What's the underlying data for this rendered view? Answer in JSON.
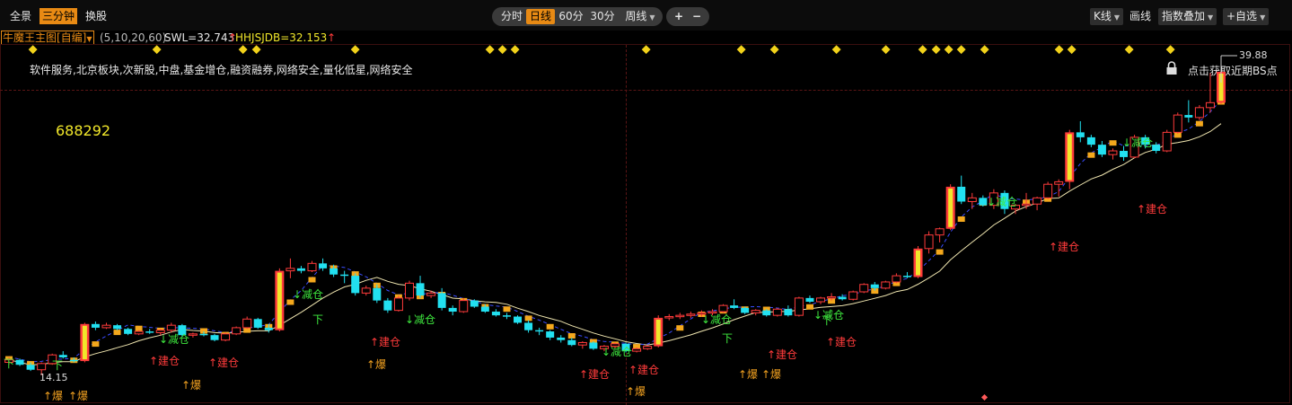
{
  "toolbar": {
    "left_tabs": [
      "全景",
      "三分钟",
      "换股"
    ],
    "active_left": "三分钟",
    "periods": [
      "分时",
      "日线",
      "60分",
      "30分"
    ],
    "active_period": "日线",
    "week_label": "周线",
    "plus_label": "+",
    "minus_label": "−",
    "kline_label": "K线",
    "draw_label": "画线",
    "index_overlay_label": "指数叠加",
    "add_watch_label": "+自选"
  },
  "legend": {
    "indicator": "牛魔王主图[自编]",
    "params": "(5,10,20,60)",
    "swl_label": "SWL=32.743",
    "swl_arrow": "↑",
    "hhjs_label": "HHJSJDB=32.153",
    "hhjs_arrow": "↑"
  },
  "stock": {
    "concepts": "软件服务,北京板块,次新股,中盘,基金增仓,融资融券,网络安全,量化低星,网络安全",
    "code": "688292",
    "high_label": "39.88",
    "low_label": "14.15",
    "bs_hint": "点击获取近期BS点"
  },
  "colors": {
    "up": "#ff3b3b",
    "down": "#22e0f0",
    "yellow_body": "#f0e62a",
    "ma_orange": "#f4a81c",
    "buy_signal": "#ff3b3b",
    "sell_signal": "#3ee83e",
    "boom_signal": "#f0a020",
    "accent": "#e88a14"
  },
  "icons": {
    "lock": "lock-icon",
    "diamond": "event-diamond-icon",
    "dropdown": "chevron-down-icon"
  },
  "signals": {
    "buy": "建仓",
    "sell": "减仓",
    "boom": "爆",
    "down": "下"
  },
  "chart_data": {
    "type": "candlestick",
    "price_range": [
      14.15,
      39.88
    ],
    "last_indicators": {
      "SWL": 32.743,
      "HHJSJDB": 32.153
    },
    "candles": [
      [
        15.2,
        15.6,
        15.0,
        15.4
      ],
      [
        15.4,
        15.5,
        14.9,
        15.0
      ],
      [
        15.0,
        15.2,
        14.5,
        14.6
      ],
      [
        14.6,
        15.2,
        14.15,
        15.1
      ],
      [
        15.1,
        15.9,
        15.0,
        15.8
      ],
      [
        15.8,
        16.1,
        15.5,
        15.6
      ],
      [
        15.4,
        15.6,
        15.2,
        15.3
      ],
      [
        15.3,
        18.4,
        15.2,
        18.3
      ],
      [
        18.3,
        18.5,
        17.8,
        18.0
      ],
      [
        18.0,
        18.4,
        17.9,
        18.2
      ],
      [
        18.2,
        18.3,
        17.8,
        17.9
      ],
      [
        17.9,
        18.0,
        17.4,
        17.5
      ],
      [
        17.5,
        17.8,
        17.4,
        17.7
      ],
      [
        17.7,
        17.9,
        17.5,
        17.6
      ],
      [
        17.6,
        17.9,
        17.4,
        17.8
      ],
      [
        17.8,
        18.4,
        17.6,
        18.2
      ],
      [
        18.2,
        18.3,
        17.3,
        17.4
      ],
      [
        17.4,
        17.6,
        17.2,
        17.5
      ],
      [
        17.5,
        17.7,
        17.3,
        17.4
      ],
      [
        17.4,
        17.5,
        16.9,
        17.0
      ],
      [
        17.0,
        17.6,
        16.9,
        17.5
      ],
      [
        17.5,
        18.1,
        17.4,
        18.0
      ],
      [
        18.0,
        18.9,
        17.9,
        18.7
      ],
      [
        18.7,
        18.8,
        17.9,
        18.0
      ],
      [
        18.0,
        18.3,
        17.6,
        17.8
      ],
      [
        17.8,
        22.8,
        17.7,
        22.6
      ],
      [
        22.6,
        23.6,
        22.0,
        22.8
      ],
      [
        22.8,
        23.0,
        22.4,
        22.6
      ],
      [
        22.6,
        23.4,
        22.5,
        23.2
      ],
      [
        23.2,
        23.6,
        22.6,
        22.8
      ],
      [
        22.8,
        23.1,
        22.1,
        22.3
      ],
      [
        22.3,
        22.6,
        21.6,
        22.2
      ],
      [
        22.2,
        22.4,
        20.6,
        20.8
      ],
      [
        20.8,
        21.4,
        20.6,
        21.2
      ],
      [
        21.2,
        21.5,
        20.0,
        20.2
      ],
      [
        20.2,
        20.4,
        19.2,
        19.4
      ],
      [
        19.4,
        20.6,
        19.3,
        20.4
      ],
      [
        20.4,
        21.8,
        20.2,
        21.6
      ],
      [
        21.6,
        22.2,
        20.4,
        20.6
      ],
      [
        20.6,
        21.0,
        20.4,
        20.8
      ],
      [
        20.8,
        21.2,
        19.4,
        19.6
      ],
      [
        19.6,
        19.8,
        19.0,
        19.3
      ],
      [
        19.3,
        20.4,
        19.2,
        20.2
      ],
      [
        20.2,
        20.3,
        19.6,
        19.7
      ],
      [
        19.7,
        19.9,
        19.2,
        19.3
      ],
      [
        19.3,
        19.5,
        18.9,
        19.0
      ],
      [
        19.0,
        19.2,
        18.7,
        18.9
      ],
      [
        18.9,
        19.0,
        18.3,
        18.4
      ],
      [
        18.4,
        18.6,
        17.6,
        17.8
      ],
      [
        17.8,
        18.0,
        17.4,
        17.7
      ],
      [
        17.7,
        17.8,
        17.0,
        17.2
      ],
      [
        17.2,
        17.4,
        16.8,
        17.0
      ],
      [
        17.0,
        17.2,
        16.5,
        16.6
      ],
      [
        16.6,
        16.9,
        16.3,
        16.8
      ],
      [
        16.8,
        16.9,
        16.2,
        16.3
      ],
      [
        16.3,
        16.6,
        16.1,
        16.5
      ],
      [
        16.5,
        16.8,
        16.3,
        16.7
      ],
      [
        16.7,
        16.8,
        16.0,
        16.1
      ],
      [
        16.1,
        16.4,
        16.0,
        16.3
      ],
      [
        16.3,
        16.6,
        16.2,
        16.5
      ],
      [
        16.5,
        19.0,
        16.4,
        18.8
      ],
      [
        18.8,
        19.1,
        18.6,
        18.9
      ],
      [
        18.9,
        19.2,
        18.7,
        19.0
      ],
      [
        19.0,
        19.3,
        18.8,
        19.1
      ],
      [
        19.1,
        19.4,
        18.9,
        19.2
      ],
      [
        19.2,
        19.5,
        19.0,
        19.3
      ],
      [
        19.3,
        19.9,
        19.2,
        19.8
      ],
      [
        19.8,
        20.3,
        19.5,
        19.6
      ],
      [
        19.6,
        19.7,
        19.1,
        19.2
      ],
      [
        19.2,
        19.5,
        19.0,
        19.4
      ],
      [
        19.4,
        19.5,
        18.9,
        19.0
      ],
      [
        19.0,
        19.6,
        18.9,
        19.5
      ],
      [
        19.5,
        19.8,
        18.9,
        19.0
      ],
      [
        19.0,
        20.5,
        18.9,
        20.4
      ],
      [
        20.4,
        20.6,
        20.0,
        20.1
      ],
      [
        20.1,
        20.5,
        19.9,
        20.4
      ],
      [
        20.4,
        20.8,
        20.2,
        20.5
      ],
      [
        20.5,
        20.7,
        20.2,
        20.3
      ],
      [
        20.3,
        21.0,
        20.2,
        20.9
      ],
      [
        20.9,
        21.6,
        20.8,
        21.5
      ],
      [
        21.5,
        21.7,
        21.0,
        21.2
      ],
      [
        21.2,
        21.8,
        21.1,
        21.7
      ],
      [
        21.7,
        22.4,
        21.6,
        22.2
      ],
      [
        22.2,
        22.5,
        22.0,
        22.1
      ],
      [
        22.1,
        24.6,
        22.0,
        24.4
      ],
      [
        24.4,
        25.8,
        24.0,
        25.5
      ],
      [
        25.5,
        26.1,
        24.9,
        26.0
      ],
      [
        26.0,
        29.6,
        25.9,
        29.4
      ],
      [
        29.4,
        30.3,
        28.0,
        28.2
      ],
      [
        28.2,
        28.9,
        27.6,
        28.5
      ],
      [
        28.5,
        28.7,
        27.8,
        27.9
      ],
      [
        27.9,
        29.2,
        27.6,
        28.9
      ],
      [
        28.9,
        29.1,
        27.2,
        27.6
      ],
      [
        27.6,
        28.0,
        27.2,
        27.9
      ],
      [
        27.9,
        28.9,
        27.6,
        28.0
      ],
      [
        28.0,
        28.6,
        27.5,
        28.5
      ],
      [
        28.5,
        29.8,
        28.4,
        29.6
      ],
      [
        29.6,
        30.0,
        28.6,
        29.8
      ],
      [
        29.8,
        34.0,
        29.2,
        33.8
      ],
      [
        33.8,
        34.7,
        33.0,
        33.4
      ],
      [
        33.4,
        33.6,
        32.6,
        32.8
      ],
      [
        32.8,
        33.1,
        31.8,
        32.0
      ],
      [
        32.0,
        32.5,
        31.6,
        32.3
      ],
      [
        32.3,
        32.7,
        31.5,
        31.8
      ],
      [
        31.8,
        33.6,
        31.7,
        33.4
      ],
      [
        33.4,
        33.6,
        32.5,
        32.8
      ],
      [
        32.8,
        33.0,
        32.1,
        32.3
      ],
      [
        32.3,
        34.0,
        32.2,
        33.8
      ],
      [
        33.8,
        35.4,
        33.7,
        35.2
      ],
      [
        35.2,
        36.4,
        34.6,
        35.0
      ],
      [
        35.0,
        36.0,
        34.8,
        35.8
      ],
      [
        35.8,
        38.6,
        35.4,
        36.2
      ],
      [
        36.2,
        38.9,
        36.1,
        38.7
      ]
    ]
  }
}
